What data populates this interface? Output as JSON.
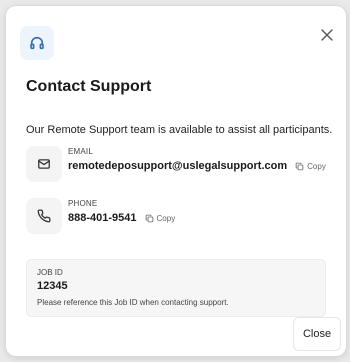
{
  "modal": {
    "title": "Contact Support",
    "description": "Our Remote Support team is available to assist all participants.",
    "header_icon": "headset-icon",
    "close_icon": "close-icon"
  },
  "email": {
    "icon": "mail-icon",
    "label": "EMAIL",
    "value": "remotedeposupport@uslegalsupport.com",
    "copy_label": "Copy"
  },
  "phone": {
    "icon": "phone-icon",
    "label": "PHONE",
    "value": "888-401-9541",
    "copy_label": "Copy"
  },
  "job": {
    "label": "JOB ID",
    "value": "12345",
    "hint": "Please reference this Job ID when contacting support."
  },
  "footer": {
    "close_label": "Close"
  },
  "colors": {
    "accent": "#2f6fb5",
    "text": "#1a1a1a",
    "muted": "#666666"
  }
}
